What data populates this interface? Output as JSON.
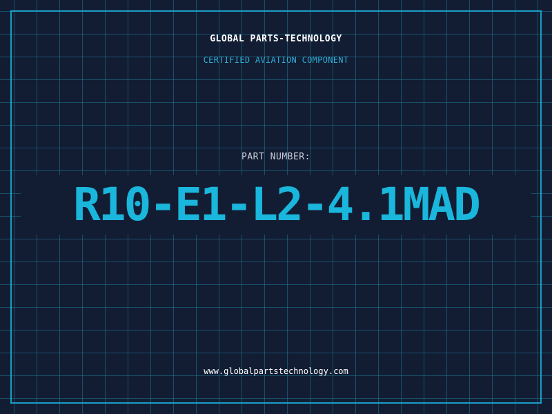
{
  "header": {
    "company": "GLOBAL PARTS-TECHNOLOGY",
    "subtitle": "CERTIFIED AVIATION COMPONENT"
  },
  "part": {
    "label": "PART NUMBER:",
    "number": "R10-E1-L2-4.1MAD"
  },
  "footer": {
    "website": "www.globalpartstechnology.com"
  },
  "colors": {
    "background": "#121d33",
    "grid": "#1d7896",
    "accent": "#1ab6dc",
    "frame": "#1a9ec6"
  }
}
